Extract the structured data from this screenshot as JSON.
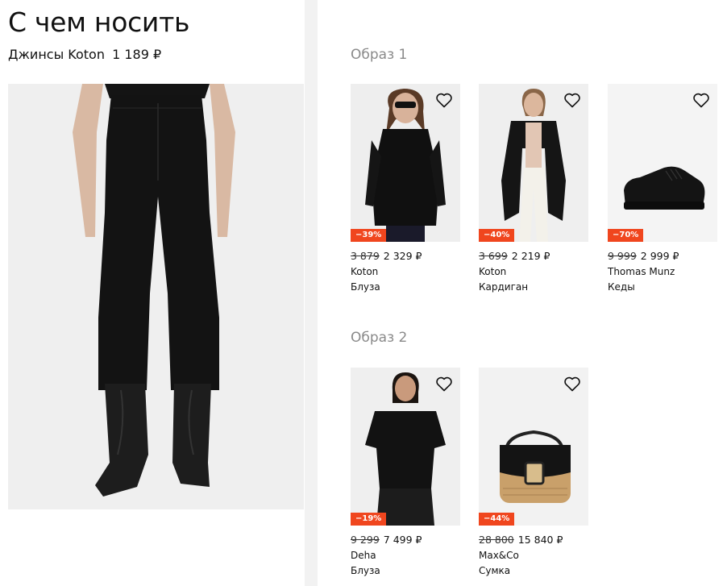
{
  "header": {
    "title": "С чем носить",
    "product_name": "Джинсы Koton",
    "product_price": "1 189 ₽"
  },
  "looks": [
    {
      "title": "Образ 1",
      "items": [
        {
          "discount": "−39%",
          "old_price": "3 879",
          "price": "2 329 ₽",
          "brand": "Koton",
          "type": "Блуза"
        },
        {
          "discount": "−40%",
          "old_price": "3 699",
          "price": "2 219 ₽",
          "brand": "Koton",
          "type": "Кардиган"
        },
        {
          "discount": "−70%",
          "old_price": "9 999",
          "price": "2 999 ₽",
          "brand": "Thomas Munz",
          "type": "Кеды"
        }
      ]
    },
    {
      "title": "Образ 2",
      "items": [
        {
          "discount": "−19%",
          "old_price": "9 299",
          "price": "7 499 ₽",
          "brand": "Deha",
          "type": "Блуза"
        },
        {
          "discount": "−44%",
          "old_price": "28 800",
          "price": "15 840 ₽",
          "brand": "Max&Co",
          "type": "Сумка"
        }
      ]
    }
  ],
  "colors": {
    "discount_badge": "#f0461e",
    "look_title": "#8a8a8a",
    "divider": "#f2f2f2"
  },
  "icons": {
    "favorite": "heart-outline-icon"
  }
}
